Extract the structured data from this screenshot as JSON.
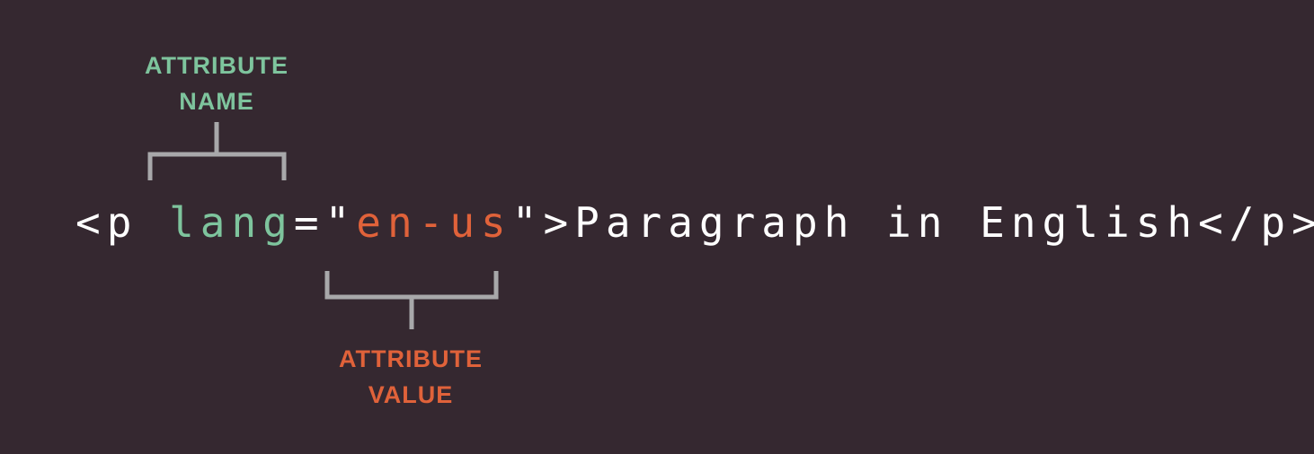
{
  "colors": {
    "background": "#352830",
    "attribute_name": "#7ec49d",
    "attribute_value": "#e0623a",
    "code_text": "#ffffff",
    "bracket": "#a8a8aa"
  },
  "labels": {
    "attribute_name": [
      "ATTRIBUTE",
      "NAME"
    ],
    "attribute_value": [
      "ATTRIBUTE",
      "VALUE"
    ]
  },
  "code": {
    "open_tag_start": "<p ",
    "attr_name": "lang",
    "equals_quote": "=\"",
    "attr_value": "en-us",
    "close_quote_tag": "\">",
    "content": "Paragraph in English",
    "close_tag": "</p>"
  }
}
